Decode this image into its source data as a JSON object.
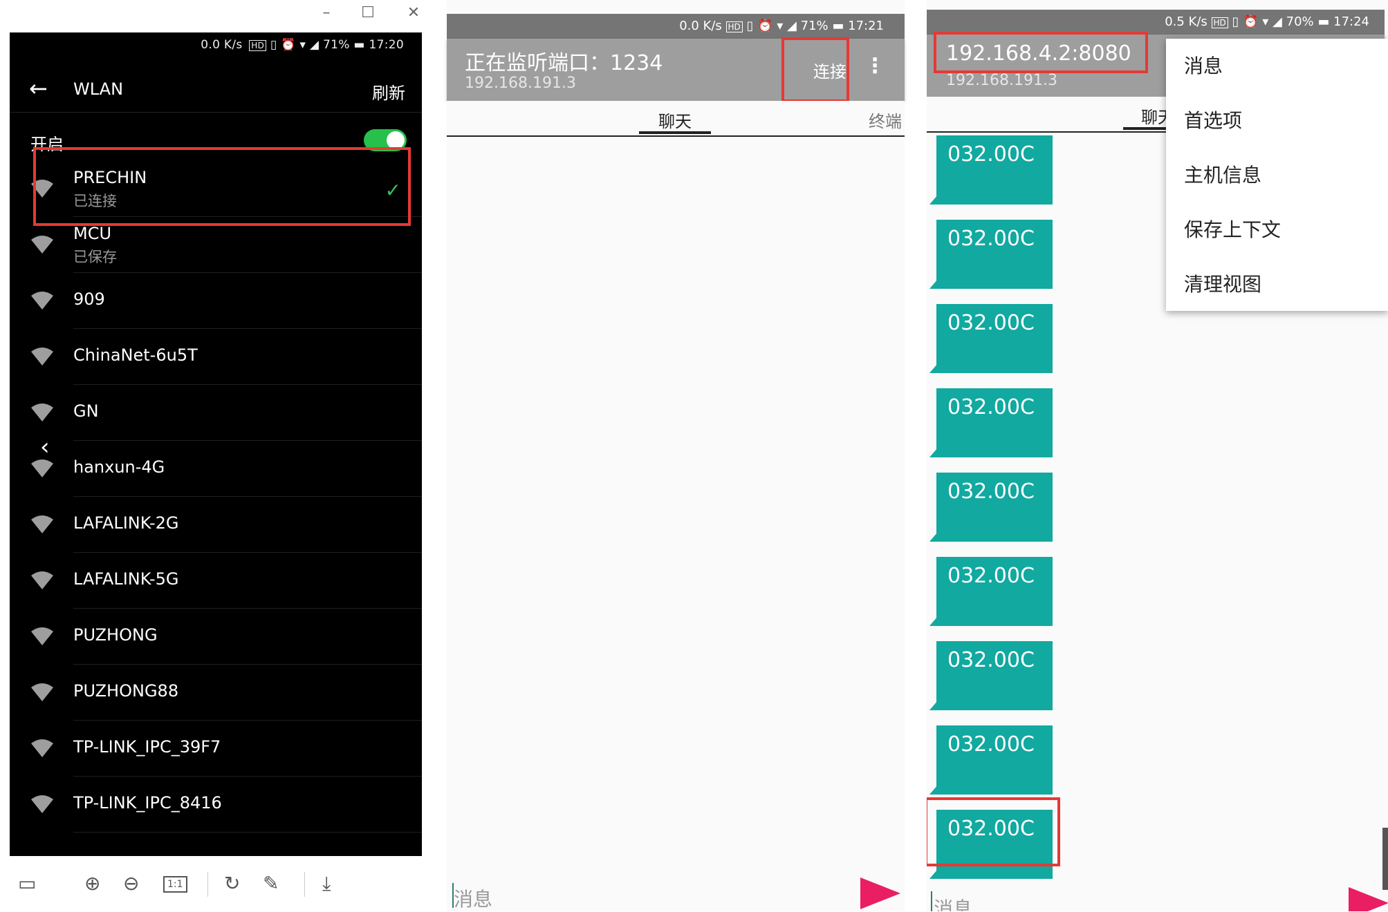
{
  "panel1": {
    "window_controls": {
      "minimize": "–",
      "maximize": "☐",
      "close": "✕"
    },
    "status": {
      "speed": "0.0 K/s",
      "hd": "HD",
      "battery": "71%",
      "time": "17:20"
    },
    "header": {
      "back_icon": "arrow-left-icon",
      "title": "WLAN",
      "refresh": "刷新"
    },
    "toggle_label": "开启",
    "toggle_on": true,
    "networks": [
      {
        "name": "PRECHIN",
        "sub": "已连接",
        "connected": true
      },
      {
        "name": "MCU",
        "sub": "已保存"
      },
      {
        "name": "909",
        "sub": ""
      },
      {
        "name": "ChinaNet-6u5T",
        "sub": ""
      },
      {
        "name": "GN",
        "sub": ""
      },
      {
        "name": "hanxun-4G",
        "sub": ""
      },
      {
        "name": "LAFALINK-2G",
        "sub": ""
      },
      {
        "name": "LAFALINK-5G",
        "sub": ""
      },
      {
        "name": "PUZHONG",
        "sub": ""
      },
      {
        "name": "PUZHONG88",
        "sub": ""
      },
      {
        "name": "TP-LINK_IPC_39F7",
        "sub": ""
      },
      {
        "name": "TP-LINK_IPC_8416",
        "sub": ""
      }
    ],
    "viewer_toolbar": {
      "icons": [
        "thumbnail-icon",
        "zoom-in-icon",
        "zoom-out-icon",
        "actual-size-icon",
        "rotate-icon",
        "edit-icon",
        "download-icon"
      ],
      "actual_size_label": "1:1"
    }
  },
  "panel2": {
    "status": {
      "speed": "0.0 K/s",
      "hd": "HD",
      "battery": "71%",
      "time": "17:21"
    },
    "appbar": {
      "title": "正在监听端口：1234",
      "subtitle": "192.168.191.3",
      "action": "连接"
    },
    "tabs": [
      "聊天",
      "终端"
    ],
    "message_placeholder": "消息"
  },
  "panel3": {
    "status": {
      "speed": "0.5 K/s",
      "hd": "HD",
      "battery": "70%",
      "time": "17:24"
    },
    "appbar": {
      "title": "192.168.4.2:8080",
      "subtitle": "192.168.191.3"
    },
    "tab_partial": "聊天",
    "bubble_text": "032.00C",
    "bubble_count": 9,
    "menu_items": [
      "消息",
      "首选项",
      "主机信息",
      "保存上下文",
      "清理视图"
    ],
    "message_placeholder": "消息"
  },
  "colors": {
    "highlight": "#e53935",
    "bubble": "#11a9a0",
    "send": "#e91e63",
    "toggle": "#27c04a"
  }
}
